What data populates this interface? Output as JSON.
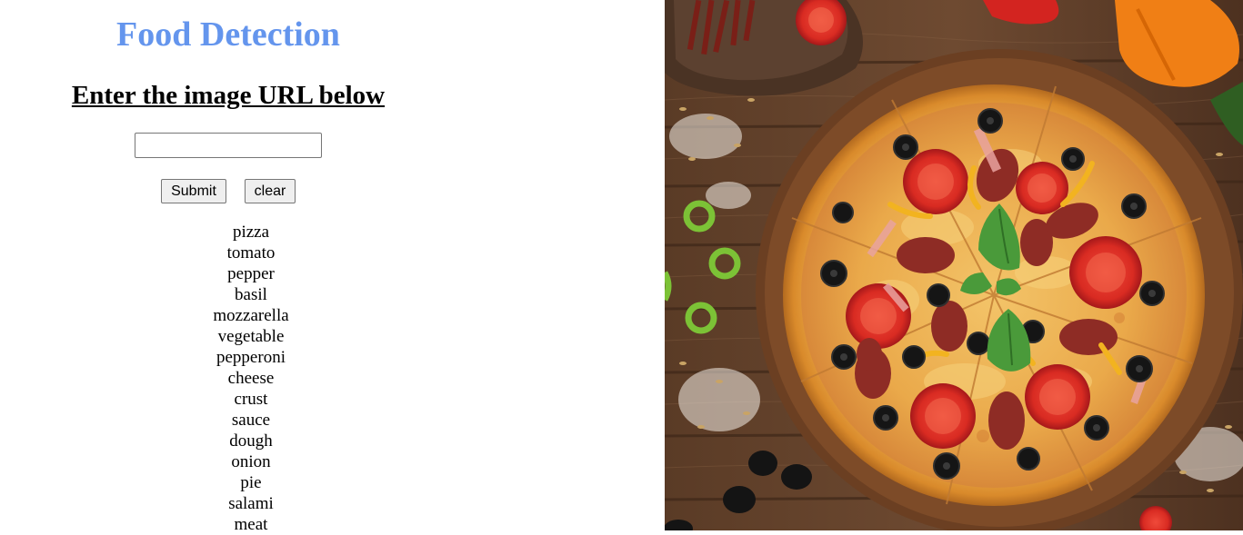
{
  "header": {
    "title": "Food Detection",
    "subtitle": "Enter the image URL below"
  },
  "form": {
    "url_value": "",
    "url_placeholder": "",
    "submit_label": "Submit",
    "clear_label": "clear"
  },
  "results": {
    "labels": [
      "pizza",
      "tomato",
      "pepper",
      "basil",
      "mozzarella",
      "vegetable",
      "pepperoni",
      "cheese",
      "crust",
      "sauce",
      "dough",
      "onion",
      "pie",
      "salami",
      "meat"
    ]
  },
  "colors": {
    "title": "#6495ed",
    "text": "#000000",
    "button_bg": "#efefef"
  }
}
